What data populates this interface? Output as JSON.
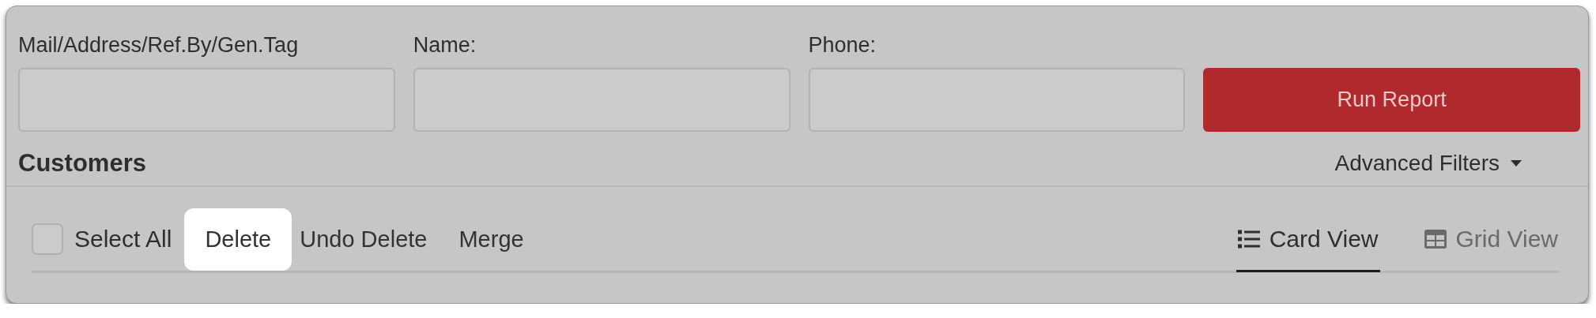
{
  "filters": [
    {
      "label": "Mail/Address/Ref.By/Gen.Tag"
    },
    {
      "label": "Name:"
    },
    {
      "label": "Phone:"
    }
  ],
  "run_button": "Run Report",
  "section_title": "Customers",
  "advanced_filters": "Advanced Filters",
  "select_all": {
    "label": "Select All",
    "checked": false
  },
  "actions": [
    {
      "label": "Delete",
      "highlighted": true
    },
    {
      "label": "Undo Delete",
      "highlighted": false
    },
    {
      "label": "Merge",
      "highlighted": false
    }
  ],
  "views": [
    {
      "label": "Card View",
      "kind": "list",
      "selected": true
    },
    {
      "label": "Grid View",
      "kind": "grid",
      "selected": false
    }
  ]
}
